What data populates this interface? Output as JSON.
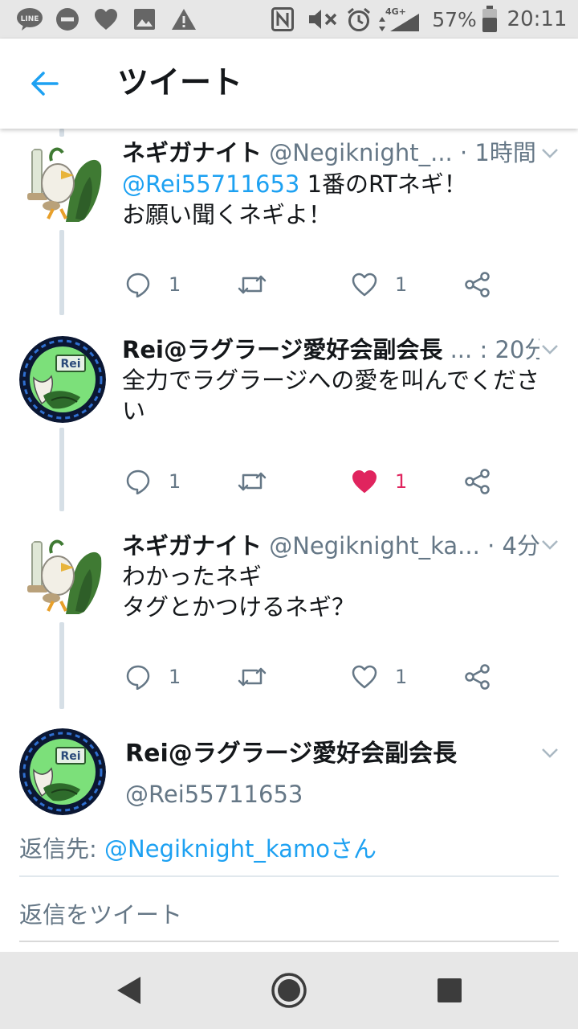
{
  "status_bar": {
    "icons": [
      "line-icon",
      "do-not-disturb-icon",
      "heart-icon",
      "image-icon",
      "warning-icon",
      "nfc-icon",
      "mute-icon",
      "alarm-icon",
      "signal-icon",
      "battery-icon"
    ],
    "network": "4G+",
    "battery": "57%",
    "time": "20:11"
  },
  "header": {
    "back_icon": "arrow-left-icon",
    "title": "ツイート"
  },
  "colors": {
    "accent": "#1da1f2",
    "like_active": "#e0245e",
    "secondary_text": "#657786",
    "thread_line": "#d6dfe6"
  },
  "tweets": [
    {
      "avatar": "sirfetchd-avatar",
      "name": "ネギガナイト",
      "handle": "@Negiknight_...",
      "time": "· 1時間",
      "mention": "@Rei55711653",
      "text": " 1番のRTネギ！\nお願い聞くネギよ！",
      "replies": "1",
      "retweets": "",
      "likes": "1",
      "liked": false
    },
    {
      "avatar": "rei-badge-avatar",
      "avatar_label": "Rei",
      "name": "Rei@ラグラージ愛好会副会長",
      "handle": "...",
      "time": ": 20分",
      "mention": "",
      "text": "全力でラグラージへの愛を叫んでくださ\nい",
      "replies": "1",
      "retweets": "",
      "likes": "1",
      "liked": true
    },
    {
      "avatar": "sirfetchd-avatar",
      "name": "ネギガナイト",
      "handle": "@Negiknight_ka...",
      "time": "· 4分",
      "mention": "",
      "text": "わかったネギ\nタグとかつけるネギ？",
      "replies": "1",
      "retweets": "",
      "likes": "1",
      "liked": false
    }
  ],
  "main_tweet": {
    "avatar_label": "Rei",
    "name": "Rei@ラグラージ愛好会副会長",
    "handle": "@Rei55711653",
    "reply_prefix": "返信先: ",
    "reply_to": "@Negiknight_kamoさん"
  },
  "reply_box": {
    "placeholder": "返信をツイート"
  },
  "nav_bar": {
    "icons": [
      "back-triangle-icon",
      "home-circle-icon",
      "recents-square-icon"
    ]
  }
}
